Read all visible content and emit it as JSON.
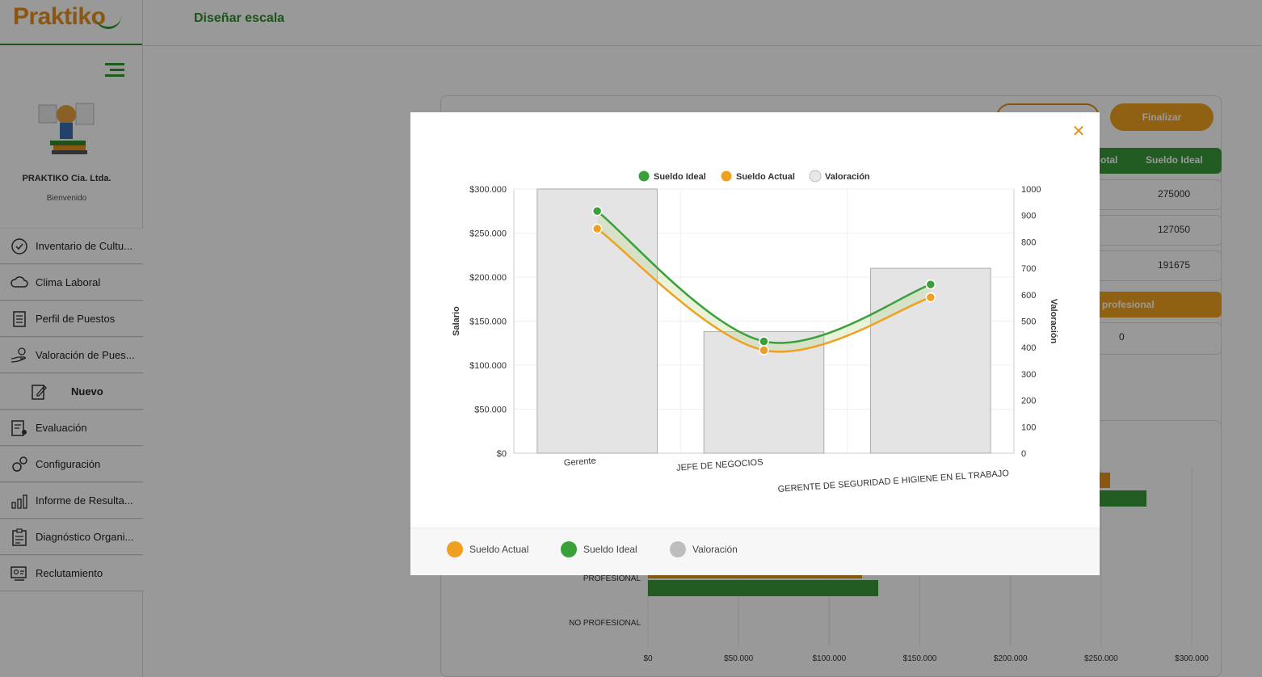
{
  "app": {
    "logo": "Praktiko",
    "page_title": "Diseñar escala",
    "company": "PRAKTIKO Cia. Ltda.",
    "welcome": "Bienvenido"
  },
  "sidebar": {
    "items": [
      {
        "label": "Inventario de Cultu...",
        "icon": "check-circle-icon"
      },
      {
        "label": "Clima Laboral",
        "icon": "cloud-icon"
      },
      {
        "label": "Perfil de Puestos",
        "icon": "document-icon"
      },
      {
        "label": "Valoración de Pues...",
        "icon": "hand-money-icon"
      },
      {
        "label": "Nuevo",
        "icon": "edit-icon"
      },
      {
        "label": "Evaluación",
        "icon": "evaluation-icon"
      },
      {
        "label": "Configuración",
        "icon": "gears-icon"
      },
      {
        "label": "Informe de Resulta...",
        "icon": "bar-chart-icon"
      },
      {
        "label": "Diagnóstico Organi...",
        "icon": "clipboard-icon"
      },
      {
        "label": "Reclutamiento",
        "icon": "recruit-icon"
      }
    ]
  },
  "toolbar": {
    "finalize_label": "Finalizar"
  },
  "table": {
    "headers": [
      "otal",
      "Sueldo Ideal"
    ],
    "rows": [
      "275000",
      "127050",
      "191675"
    ],
    "section_label": "profesional",
    "section_value": "0"
  },
  "background_chart": {
    "categories": [
      "PROFESIONAL",
      "NO PROFESIONAL"
    ],
    "x_ticks": [
      "$0",
      "$50.000",
      "$100.000",
      "$150.000",
      "$200.000",
      "$250.000",
      "$300.000"
    ]
  },
  "modal": {
    "close_icon": "close-icon",
    "footer_legend": [
      {
        "label": "Sueldo Actual",
        "color": "#f0a020"
      },
      {
        "label": "Sueldo Ideal",
        "color": "#3aa03a"
      },
      {
        "label": "Valoración",
        "color": "#bdbdbd"
      }
    ]
  },
  "chart_data": {
    "type": "bar",
    "categories": [
      "Gerente",
      "JEFE DE NEGOCIOS",
      "GERENTE DE SEGURIDAD E HIGIENE EN EL TRABAJO"
    ],
    "legend": [
      "Sueldo Ideal",
      "Sueldo Actual",
      "Valoración"
    ],
    "series": [
      {
        "name": "Sueldo Ideal",
        "type": "line",
        "axis": "left",
        "color": "#3aa03a",
        "values": [
          275000,
          127050,
          191675
        ]
      },
      {
        "name": "Sueldo Actual",
        "type": "line",
        "axis": "left",
        "color": "#f0a020",
        "values": [
          255000,
          117000,
          177000
        ]
      },
      {
        "name": "Valoración",
        "type": "bar",
        "axis": "right",
        "color": "#e4e4e4",
        "values": [
          1000,
          460,
          700
        ]
      }
    ],
    "ylabel": "Salario",
    "y2label": "Valoración",
    "ylim": [
      0,
      300000
    ],
    "y2lim": [
      0,
      1000
    ],
    "y_ticks": [
      "$0",
      "$50.000",
      "$100.000",
      "$150.000",
      "$200.000",
      "$250.000",
      "$300.000"
    ],
    "y2_ticks": [
      "0",
      "100",
      "200",
      "300",
      "400",
      "500",
      "600",
      "700",
      "800",
      "900",
      "1000"
    ],
    "legend_position": "top",
    "grid": true
  }
}
